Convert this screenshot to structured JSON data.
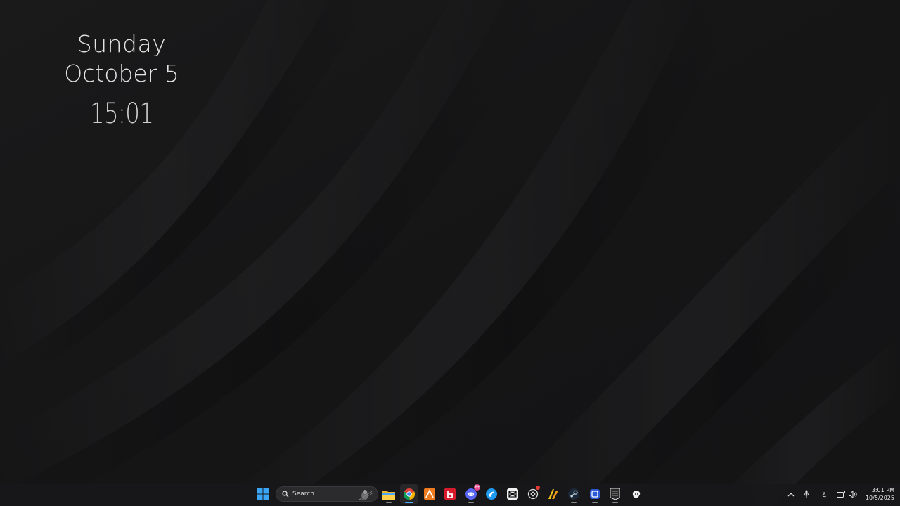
{
  "desktop": {
    "widget": {
      "day": "Sunday",
      "date": "October 5",
      "time": "15:01"
    }
  },
  "taskbar": {
    "start_icon": "windows-logo-icon",
    "search": {
      "label": "Search",
      "icon": "search-icon"
    },
    "apps": [
      {
        "name": "file-explorer-icon"
      },
      {
        "name": "chrome-icon",
        "active": true
      },
      {
        "name": "app-orange-icon"
      },
      {
        "name": "app-red-icon"
      },
      {
        "name": "discord-icon",
        "badge": "9+"
      },
      {
        "name": "app-blue-icon"
      },
      {
        "name": "capcut-icon"
      },
      {
        "name": "app-circle-icon"
      },
      {
        "name": "app-yellow-icon"
      },
      {
        "name": "steam-icon"
      },
      {
        "name": "app-blue-box-icon"
      },
      {
        "name": "epic-games-icon"
      },
      {
        "name": "app-white-icon"
      }
    ],
    "tray": {
      "overflow_icon": "chevron-up-icon",
      "mic_icon": "microphone-icon",
      "language": "ع",
      "network_icon": "network-icon",
      "volume_icon": "volume-icon",
      "time": "3:01 PM",
      "date": "10/5/2025"
    }
  },
  "colors": {
    "background": "#161617",
    "taskbar": "#18181a",
    "accent_blue": "#4aa8ff",
    "discord_badge": "#e84a8f"
  }
}
